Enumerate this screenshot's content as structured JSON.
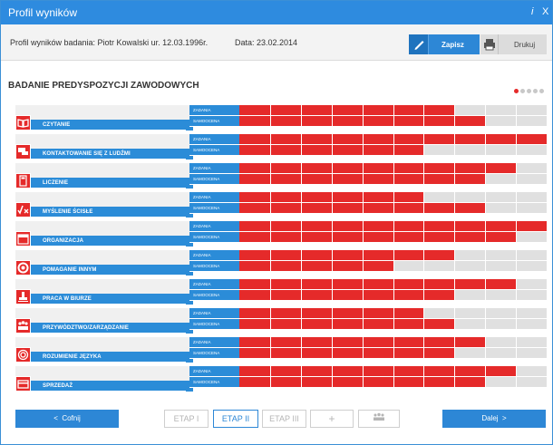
{
  "window": {
    "title": "Profil wyników",
    "help_icon": "i",
    "close_icon": "X"
  },
  "toolbar": {
    "info": "Profil wyników badania: Piotr Kowalski ur. 12.03.1996r.",
    "date": "Data: 23.02.2014",
    "save_label": "Zapisz",
    "print_label": "Drukuj",
    "save_icon": "pencil-icon",
    "print_icon": "printer-icon"
  },
  "section": {
    "heading": "BADANIE PREDYSPOZYCJI ZAWODOWYCH",
    "page_dots": 5,
    "active_dot": 1
  },
  "series_labels": {
    "first": "ZADANIA",
    "second": "SAMOOCENA"
  },
  "scale_max": 10,
  "categories": [
    {
      "label": "CZYTANIE",
      "icon": "book-icon",
      "zadania": 7,
      "samoocena": 8
    },
    {
      "label": "KONTAKTOWANIE SIĘ Z LUDŹMI",
      "icon": "chat-icon",
      "zadania": 10,
      "samoocena": 6
    },
    {
      "label": "LICZENIE",
      "icon": "calculator-icon",
      "zadania": 9,
      "samoocena": 8
    },
    {
      "label": "MYŚLENIE ŚCISŁE",
      "icon": "sqrt-icon",
      "zadania": 6,
      "samoocena": 8
    },
    {
      "label": "ORGANIZACJA",
      "icon": "calendar-icon",
      "zadania": 10,
      "samoocena": 9
    },
    {
      "label": "POMAGANIE INNYM",
      "icon": "lifebuoy-icon",
      "zadania": 7,
      "samoocena": 5
    },
    {
      "label": "PRACA W BIURZE",
      "icon": "stamp-icon",
      "zadania": 9,
      "samoocena": 7
    },
    {
      "label": "PRZYWÓDZTWO/ZARZĄDZANIE",
      "icon": "team-icon",
      "zadania": 6,
      "samoocena": 7
    },
    {
      "label": "ROZUMIENIE JĘZYKA",
      "icon": "target-icon",
      "zadania": 8,
      "samoocena": 7
    },
    {
      "label": "SPRZEDAŻ",
      "icon": "card-icon",
      "zadania": 9,
      "samoocena": 8
    }
  ],
  "footer": {
    "back_label": "Cofnij",
    "next_label": "Dalej",
    "back_arrow": "<",
    "next_arrow": ">",
    "stages": [
      "ETAP I",
      "ETAP II",
      "ETAP III",
      "+",
      "people-icon"
    ],
    "active_stage": 1
  },
  "colors": {
    "accent": "#2b8cd8",
    "score": "#e52a2a",
    "track": "#e0e0e0"
  }
}
